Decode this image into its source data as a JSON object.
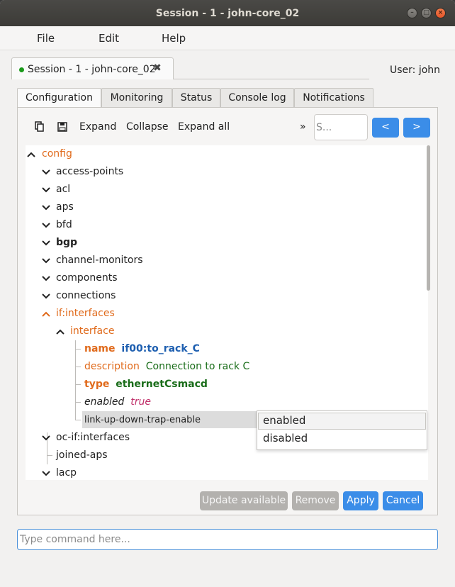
{
  "window": {
    "title": "Session - 1 - john-core_02"
  },
  "menu": {
    "file": "File",
    "edit": "Edit",
    "help": "Help"
  },
  "session_tab": {
    "label": "Session - 1 - john-core_02",
    "close": "✖",
    "status_color": "#1a9a1a"
  },
  "user": "User: john",
  "tabs": [
    "Configuration",
    "Monitoring",
    "Status",
    "Console log",
    "Notifications"
  ],
  "toolbar": {
    "expand": "Expand",
    "collapse": "Collapse",
    "expand_all": "Expand all",
    "more": "»",
    "search_placeholder": "S...",
    "prev": "<",
    "next": ">"
  },
  "tree": {
    "config": "config",
    "items": [
      "access-points",
      "acl",
      "aps",
      "bfd",
      "bgp",
      "channel-monitors",
      "components",
      "connections"
    ],
    "if_interfaces": "if:interfaces",
    "interface": "interface",
    "name_key": "name",
    "name_val": "if00:to_rack_C",
    "desc_key": "description",
    "desc_val": "Connection to rack C",
    "type_key": "type",
    "type_val": "ethernetCsmacd",
    "enabled_key": "enabled",
    "enabled_val": "true",
    "link_trap": "link-up-down-trap-enable",
    "oc_if": "oc-if:interfaces",
    "joined_aps": "joined-aps",
    "lacp": "lacp"
  },
  "dropdown": {
    "options": [
      "enabled",
      "disabled"
    ]
  },
  "actions": {
    "update": "Update available",
    "remove": "Remove",
    "apply": "Apply",
    "cancel": "Cancel"
  },
  "command_placeholder": "Type command here...",
  "colors": {
    "accent": "#3b8de8",
    "key_orange": "#e06a1b",
    "value_blue": "#1e5fb0",
    "value_green": "#1a6d1a",
    "value_pink": "#c0306a"
  }
}
